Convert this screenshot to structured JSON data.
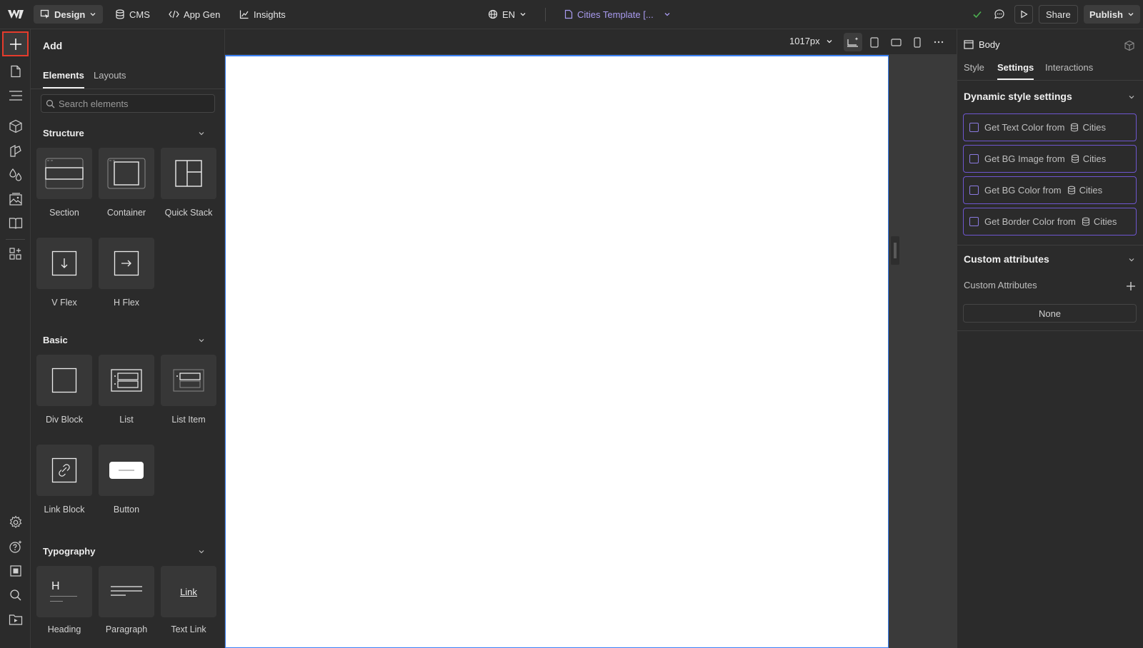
{
  "topbar": {
    "mode_label": "Design",
    "cms_label": "CMS",
    "appgen_label": "App Gen",
    "insights_label": "Insights",
    "locale_label": "EN",
    "page_label": "Cities Template [...",
    "share_label": "Share",
    "publish_label": "Publish"
  },
  "add_panel": {
    "title": "Add",
    "tabs": [
      "Elements",
      "Layouts"
    ],
    "search_placeholder": "Search elements",
    "sections": {
      "structure": {
        "title": "Structure",
        "items": [
          "Section",
          "Container",
          "Quick Stack",
          "V Flex",
          "H Flex"
        ]
      },
      "basic": {
        "title": "Basic",
        "items": [
          "Div Block",
          "List",
          "List Item",
          "Link Block",
          "Button"
        ]
      },
      "typography": {
        "title": "Typography",
        "items": [
          "Heading",
          "Paragraph",
          "Text Link"
        ],
        "link_glyph": "Link",
        "heading_glyph": "H"
      }
    }
  },
  "canvas": {
    "width_label": "1017px"
  },
  "right_panel": {
    "element_label": "Body",
    "tabs": [
      "Style",
      "Settings",
      "Interactions"
    ],
    "dynamic": {
      "title": "Dynamic style settings",
      "items": [
        {
          "label": "Get Text Color from",
          "source": "Cities"
        },
        {
          "label": "Get BG Image from",
          "source": "Cities"
        },
        {
          "label": "Get BG Color from",
          "source": "Cities"
        },
        {
          "label": "Get Border Color from",
          "source": "Cities"
        }
      ]
    },
    "custom": {
      "title": "Custom attributes",
      "label": "Custom Attributes",
      "value": "None"
    }
  },
  "colors": {
    "accent_purple": "#6e56cf",
    "selection_red": "#e53b2c",
    "canvas_blue": "#3b82f6",
    "page_link": "#a99bf0",
    "check_green": "#4caf50"
  }
}
